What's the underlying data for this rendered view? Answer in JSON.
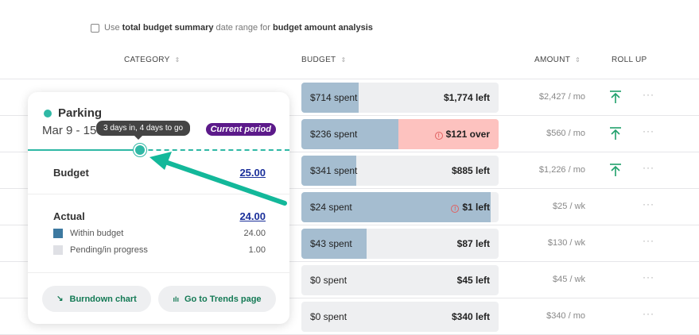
{
  "option": {
    "pre": "Use",
    "b1": "total budget summary",
    "mid": "date range for",
    "b2": "budget amount analysis",
    "checked": false
  },
  "headers": {
    "category": "CATEGORY",
    "budget": "BUDGET",
    "amount": "AMOUNT",
    "rollup": "ROLL UP"
  },
  "rows": [
    {
      "spent": "$714 spent",
      "remain": "$1,774 left",
      "amount": "$2,427 / mo",
      "fill": 0.29,
      "warn": false,
      "over": false,
      "rollup": true
    },
    {
      "spent": "$236 spent",
      "remain": "$121 over",
      "amount": "$560 / mo",
      "fill": 0.49,
      "warn": true,
      "over": true,
      "rollup": true
    },
    {
      "spent": "$341 spent",
      "remain": "$885 left",
      "amount": "$1,226 / mo",
      "fill": 0.28,
      "warn": false,
      "over": false,
      "rollup": true
    },
    {
      "spent": "$24 spent",
      "remain": "$1 left",
      "amount": "$25 / wk",
      "fill": 0.96,
      "warn": true,
      "over": false,
      "rollup": false
    },
    {
      "spent": "$43 spent",
      "remain": "$87 left",
      "amount": "$130 / wk",
      "fill": 0.33,
      "warn": false,
      "over": false,
      "rollup": false
    },
    {
      "spent": "$0 spent",
      "remain": "$45 left",
      "amount": "$45 / wk",
      "fill": 0,
      "warn": false,
      "over": false,
      "rollup": false
    },
    {
      "spent": "$0 spent",
      "remain": "$340 left",
      "amount": "$340 / mo",
      "fill": 0,
      "warn": false,
      "over": false,
      "rollup": false
    }
  ],
  "card": {
    "title": "Parking",
    "date": "Mar 9 - 15",
    "badge": "Current period",
    "tooltip": "3 days in, 4 days to go",
    "budget_label": "Budget",
    "budget_value": "25.00",
    "actual_label": "Actual",
    "actual_value": "24.00",
    "legend": [
      {
        "label": "Within budget",
        "value": "24.00",
        "color": "#3d79a0"
      },
      {
        "label": "Pending/in progress",
        "value": "1.00",
        "color": "#dfe0e5"
      }
    ],
    "burndown": "Burndown chart",
    "trends": "Go to Trends page"
  },
  "colors": {
    "accent": "#2fb8a5",
    "fill": "#a5bdd0",
    "over": "#fdc2bf",
    "rollup": "#1fa06b",
    "badge": "#5c1a8a"
  }
}
